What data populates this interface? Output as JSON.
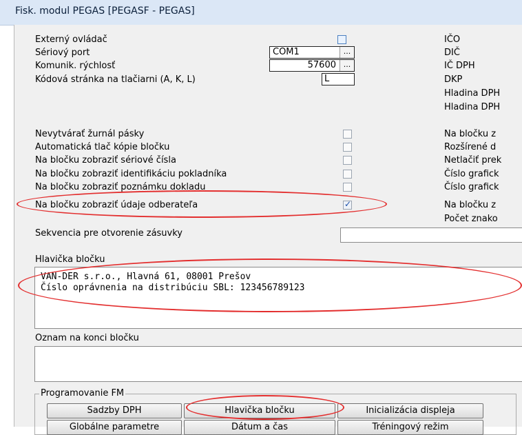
{
  "window": {
    "title": "Fisk. modul  PEGAS   [PEGASF - PEGAS]"
  },
  "left": {
    "external_driver_label": "Externý ovládač",
    "serial_port_label": "Sériový port",
    "serial_port_value": "COM1",
    "baud_label": "Komunik. rýchlosť",
    "baud_value": "57600",
    "codepage_label": "Kódová stránka na tlačiarni (A, K, L)",
    "codepage_value": "L",
    "ellipsis": "..."
  },
  "checkbox_rows": [
    {
      "label": "Nevytvárať  žurnál pásky",
      "checked": false
    },
    {
      "label": "Automatická tlač kópie bločku",
      "checked": false
    },
    {
      "label": "Na bločku zobraziť sériové čísla",
      "checked": false
    },
    {
      "label": "Na bločku zobraziť identifikáciu pokladníka",
      "checked": false
    },
    {
      "label": "Na bločku zobraziť poznámku dokladu",
      "checked": false
    },
    {
      "label": "Na bločku zobraziť údaje odberateľa",
      "checked": true
    }
  ],
  "check_mark": "✓",
  "right_labels_top": [
    "IČO",
    "DIČ",
    "IČ DPH",
    "DKP",
    "Hladina DPH",
    "Hladina DPH"
  ],
  "right_labels_bottom": [
    "Na bločku z",
    "Rozšírené d",
    "Netlačiť prek",
    "Číslo grafick",
    "Číslo grafick",
    "Na bločku z",
    "Počet znako"
  ],
  "drawer": {
    "label": "Sekvencia pre otvorenie zásuvky"
  },
  "header_box": {
    "label": "Hlavička bločku",
    "line1": "VAN-DER s.r.o., Hlavná 61, 08001 Prešov",
    "line2": "Číslo oprávnenia na distribúciu SBL: 123456789123"
  },
  "footer_box": {
    "label": "Oznam na konci bločku"
  },
  "fm_group": {
    "legend": "Programovanie FM",
    "buttons": [
      "Sadzby DPH",
      "Hlavička bločku",
      "Inicializácia displeja",
      "Globálne parametre",
      "Dátum a čas",
      "Tréningový režim"
    ]
  },
  "colors": {
    "highlight": "#e32e2e",
    "titlebar": "#dbe7f6",
    "dialog": "#f0f0f0"
  }
}
